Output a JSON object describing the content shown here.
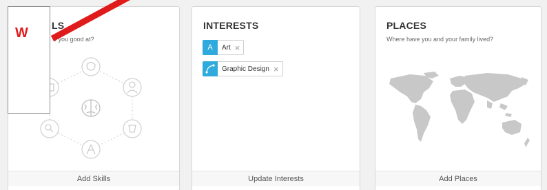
{
  "skills": {
    "title": "SKILLS",
    "title_visible": "LS",
    "subtitle": "What are you good at?",
    "subtitle_visible": "e you good at?",
    "action": "Add Skills"
  },
  "interests": {
    "title": "INTERESTS",
    "tags": [
      {
        "label": "Art",
        "icon_text": "A",
        "icon": "letter-a-icon"
      },
      {
        "label": "Graphic Design",
        "icon_text": "",
        "icon": "bezier-curve-icon"
      }
    ],
    "action": "Update Interests"
  },
  "places": {
    "title": "PLACES",
    "subtitle": "Where have you and your family lived?",
    "action": "Add Places"
  },
  "overlay": {
    "letter": "W"
  },
  "colors": {
    "tag_accent": "#2eaadc",
    "overlay_red": "#e01b1b"
  }
}
